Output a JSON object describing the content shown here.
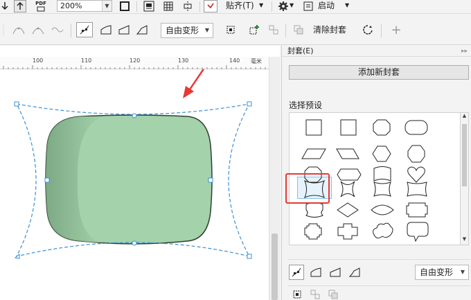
{
  "toolbar1": {
    "zoom_value": "200%",
    "snap_label": "贴齐(T)",
    "launch_label": "启动",
    "pdf_label": "PDF"
  },
  "toolbar2": {
    "mode_select": "自由变形",
    "clear_envelope_label": "清除封套"
  },
  "ruler": {
    "ticks": [
      "100",
      "110",
      "120",
      "130",
      "140"
    ],
    "unit": "毫米"
  },
  "canvas": {
    "shape_fill": "#a4d2ab",
    "shape_shadow": "#76a37e",
    "envelope_color": "#3a8fd6",
    "arrow_color": "#e53935"
  },
  "docker": {
    "title": "封套(E)",
    "add_button": "添加新封套",
    "presets_label": "选择预设",
    "mode_select": "自由变形",
    "presets": [
      "square",
      "square-2",
      "octagon",
      "rounded-rect",
      "parallelogram",
      "parallelogram-rev",
      "hexagon",
      "octagon-2",
      "octagon-3",
      "arrow-hex",
      "flag-wave",
      "heart",
      "pinched-rect",
      "star-4",
      "wave-pinch",
      "wave-pinch-2",
      "scalloped-rect",
      "diamond",
      "lens",
      "stepped-rect",
      "stepped-octagon",
      "cross",
      "cloud",
      "speech-bubble"
    ],
    "selected_preset": "pinched-rect"
  }
}
